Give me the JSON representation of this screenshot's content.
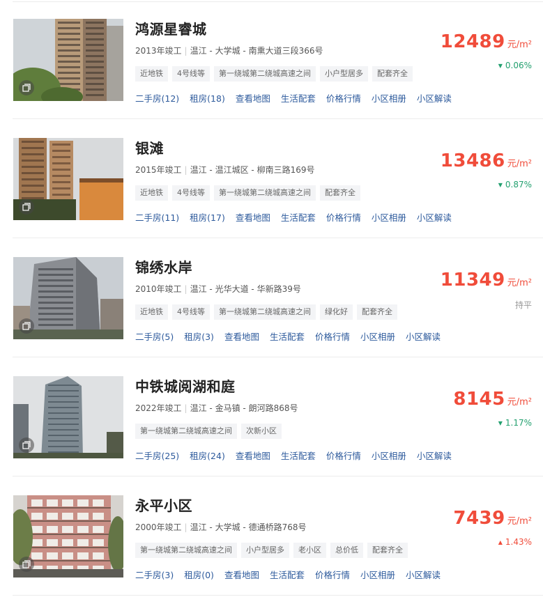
{
  "unit": "元/m²",
  "communities": [
    {
      "name": "鸿源星睿城",
      "year": "2013年竣工",
      "district": "温江",
      "area": "大学城",
      "address": "南熏大道三段366号",
      "tags": [
        "近地铁",
        "4号线等",
        "第一绕城第二绕城高速之间",
        "小户型居多",
        "配套齐全"
      ],
      "price": "12489",
      "trend": "down",
      "trend_icon": "arrow-down-icon",
      "change": "0.06%",
      "links": [
        "二手房(12)",
        "租房(18)",
        "查看地图",
        "生活配套",
        "价格行情",
        "小区相册",
        "小区解读"
      ]
    },
    {
      "name": "银滩",
      "year": "2015年竣工",
      "district": "温江",
      "area": "温江城区",
      "address": "柳南三路169号",
      "tags": [
        "近地铁",
        "4号线等",
        "第一绕城第二绕城高速之间",
        "配套齐全"
      ],
      "price": "13486",
      "trend": "down",
      "trend_icon": "arrow-down-icon",
      "change": "0.87%",
      "links": [
        "二手房(11)",
        "租房(17)",
        "查看地图",
        "生活配套",
        "价格行情",
        "小区相册",
        "小区解读"
      ]
    },
    {
      "name": "锦绣水岸",
      "year": "2010年竣工",
      "district": "温江",
      "area": "光华大道",
      "address": "华新路39号",
      "tags": [
        "近地铁",
        "4号线等",
        "第一绕城第二绕城高速之间",
        "绿化好",
        "配套齐全"
      ],
      "price": "11349",
      "trend": "flat",
      "trend_icon": "",
      "change": "持平",
      "links": [
        "二手房(5)",
        "租房(3)",
        "查看地图",
        "生活配套",
        "价格行情",
        "小区相册",
        "小区解读"
      ]
    },
    {
      "name": "中铁城阅湖和庭",
      "year": "2022年竣工",
      "district": "温江",
      "area": "金马镇",
      "address": "朗河路868号",
      "tags": [
        "第一绕城第二绕城高速之间",
        "次新小区"
      ],
      "price": "8145",
      "trend": "down",
      "trend_icon": "arrow-down-icon",
      "change": "1.17%",
      "links": [
        "二手房(25)",
        "租房(24)",
        "查看地图",
        "生活配套",
        "价格行情",
        "小区相册",
        "小区解读"
      ]
    },
    {
      "name": "永平小区",
      "year": "2000年竣工",
      "district": "温江",
      "area": "大学城",
      "address": "德通桥路768号",
      "tags": [
        "第一绕城第二绕城高速之间",
        "小户型居多",
        "老小区",
        "总价低",
        "配套齐全"
      ],
      "price": "7439",
      "trend": "up",
      "trend_icon": "arrow-up-icon",
      "change": "1.43%",
      "links": [
        "二手房(3)",
        "租房(0)",
        "查看地图",
        "生活配套",
        "价格行情",
        "小区相册",
        "小区解读"
      ]
    }
  ]
}
